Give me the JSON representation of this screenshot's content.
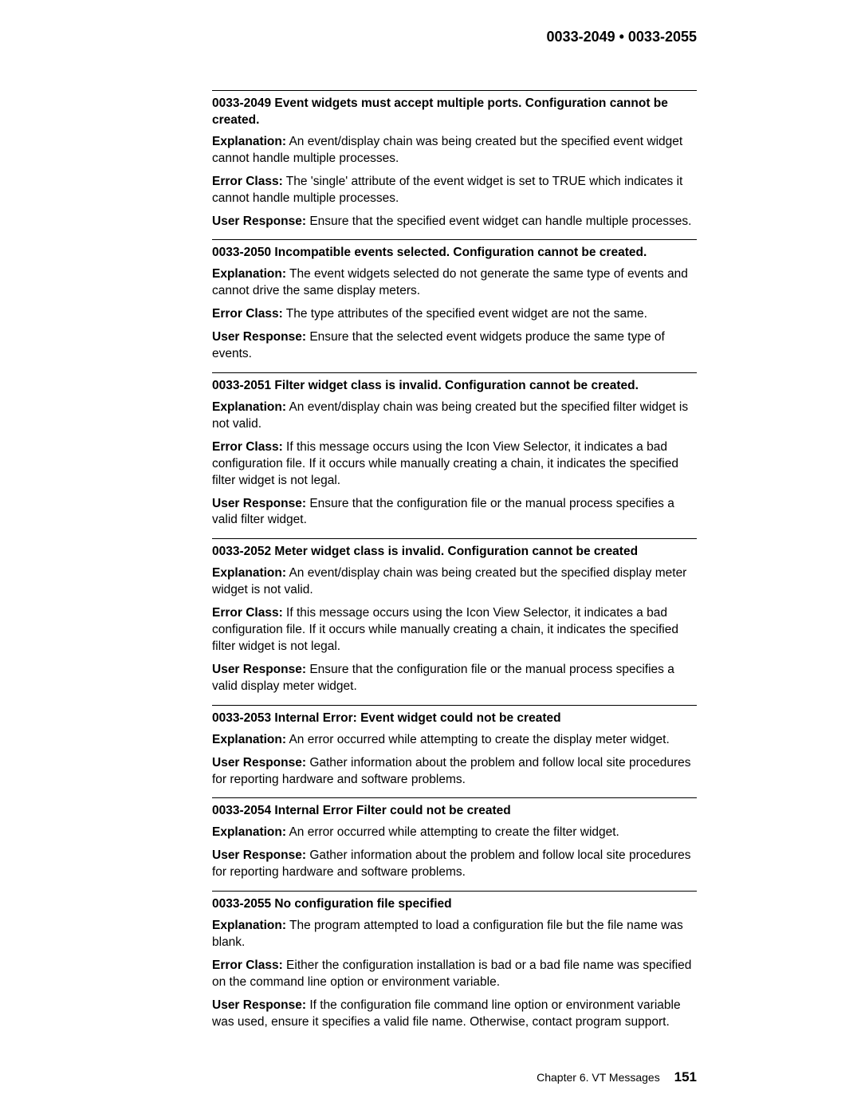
{
  "header": "0033-2049 • 0033-2055",
  "labels": {
    "explanation": "Explanation:",
    "error_class": "Error Class:",
    "user_response": "User Response:"
  },
  "entries": [
    {
      "title": "0033-2049 Event widgets must accept multiple ports. Configuration cannot be created.",
      "explanation": "An event/display chain was being created but the specified event widget cannot handle multiple processes.",
      "error_class": "The 'single' attribute of the event widget is set to TRUE which indicates it cannot handle multiple processes.",
      "user_response": "Ensure that the specified event widget can handle multiple processes."
    },
    {
      "title": "0033-2050 Incompatible events selected. Configuration cannot be created.",
      "explanation": "The event widgets selected do not generate the same type of events and cannot drive the same display meters.",
      "error_class": "The type attributes of the specified event widget are not the same.",
      "user_response": "Ensure that the selected event widgets produce the same type of events."
    },
    {
      "title": "0033-2051 Filter widget class is invalid. Configuration cannot be created.",
      "explanation": "An event/display chain was being created but the specified filter widget is not valid.",
      "error_class": "If this message occurs using the Icon View Selector, it indicates a bad configuration file. If it occurs while manually creating a chain, it indicates the specified filter widget is not legal.",
      "user_response": "Ensure that the configuration file or the manual process specifies a valid filter widget."
    },
    {
      "title": "0033-2052 Meter widget class is invalid. Configuration cannot be created",
      "explanation": "An event/display chain was being created but the specified display meter widget is not valid.",
      "error_class": "If this message occurs using the Icon View Selector, it indicates a bad configuration file. If it occurs while manually creating a chain, it indicates the specified filter widget is not legal.",
      "user_response": "Ensure that the configuration file or the manual process specifies a valid display meter widget."
    },
    {
      "title": "0033-2053 Internal Error: Event widget could not be created",
      "explanation": "An error occurred while attempting to create the display meter widget.",
      "error_class": "",
      "user_response": "Gather information about the problem and follow local site procedures for reporting hardware and software problems."
    },
    {
      "title": "0033-2054 Internal Error Filter could not be created",
      "explanation": "An error occurred while attempting to create the filter widget.",
      "error_class": "",
      "user_response": "Gather information about the problem and follow local site procedures for reporting hardware and software problems."
    },
    {
      "title": "0033-2055 No configuration file specified",
      "explanation": "The program attempted to load a configuration file but the file name was blank.",
      "error_class": "Either the configuration installation is bad or a bad file name was specified on the command line option or environment variable.",
      "user_response": "If the configuration file command line option or environment variable was used, ensure it specifies a valid file name. Otherwise, contact program support."
    }
  ],
  "footer": {
    "chapter": "Chapter 6.  VT Messages",
    "page": "151"
  }
}
